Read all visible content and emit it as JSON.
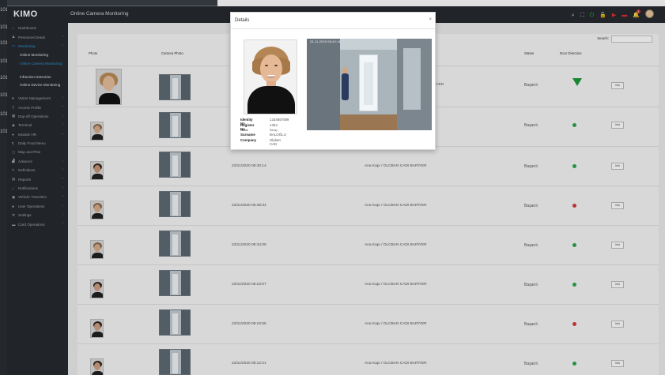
{
  "left_edge_labels": [
    "101",
    "101",
    "101",
    "101",
    "101",
    "101",
    "101",
    "101"
  ],
  "app": {
    "logo": "KIMO",
    "title": "Online Camera Monitoring"
  },
  "sidebar": {
    "items": [
      {
        "label": "Dashboard",
        "icon": "home-icon"
      },
      {
        "label": "Personnel Detail",
        "icon": "users-icon",
        "arrow": "‹"
      },
      {
        "label": "Monitoring",
        "icon": "monitor-icon",
        "arrow": "‹"
      },
      {
        "label": "Online Monitoring"
      },
      {
        "label": "Online Camera Monitoring"
      },
      {
        "label": "Infraction Detection"
      },
      {
        "label": "Online Device Monitoring"
      },
      {
        "label": "Visitor Management",
        "icon": "visitor-icon",
        "arrow": "‹"
      },
      {
        "label": "Access Profile",
        "icon": "key-icon",
        "arrow": "‹"
      },
      {
        "label": "Day-off Operations",
        "icon": "calendar-icon",
        "arrow": "‹"
      },
      {
        "label": "Terminal",
        "icon": "terminal-icon",
        "arrow": "‹"
      },
      {
        "label": "Module HR",
        "icon": "hr-icon",
        "arrow": "‹"
      },
      {
        "label": "Daily Food Menu",
        "icon": "food-icon"
      },
      {
        "label": "Map and Plan",
        "icon": "map-icon"
      },
      {
        "label": "Advance",
        "icon": "chart-icon",
        "arrow": "‹"
      },
      {
        "label": "Definitions",
        "icon": "pencil-icon",
        "arrow": "‹"
      },
      {
        "label": "Reports",
        "icon": "report-icon",
        "arrow": "‹"
      },
      {
        "label": "Notifications",
        "icon": "bell-icon",
        "arrow": "‹"
      },
      {
        "label": "Vehicle Transition",
        "icon": "car-icon",
        "arrow": "‹"
      },
      {
        "label": "User Operations",
        "icon": "user-ops-icon",
        "arrow": "‹"
      },
      {
        "label": "Settings",
        "icon": "wrench-icon",
        "arrow": "‹"
      },
      {
        "label": "Card Operations",
        "icon": "card-icon",
        "arrow": "‹"
      }
    ]
  },
  "topbar": {
    "icons": [
      {
        "name": "search-icon",
        "glyph": "⌕",
        "color": "#cfd3d7"
      },
      {
        "name": "expand-icon",
        "glyph": "⛶",
        "color": "#cfd3d7"
      },
      {
        "name": "power-icon",
        "glyph": "⏻",
        "color": "#27b24a"
      },
      {
        "name": "unlock-icon",
        "glyph": "🔓",
        "color": "#27b24a"
      },
      {
        "name": "camera-icon",
        "glyph": "▶",
        "color": "#d93030"
      },
      {
        "name": "flag-icon",
        "glyph": "▬",
        "color": "#d93030"
      },
      {
        "name": "notification-icon",
        "glyph": "🔔",
        "color": "#d93030"
      }
    ],
    "notification_badge": "1"
  },
  "table": {
    "search_label": "Search:",
    "headers": [
      "Photo",
      "Camera Photo",
      "Status",
      "Door Direction"
    ],
    "rows": [
      {
        "time": "",
        "door": "IYER",
        "status": "Başarılı",
        "direction": "in",
        "info": "Info"
      },
      {
        "time": "",
        "door": "",
        "status": "Başarılı",
        "direction": "in",
        "info": "Info"
      },
      {
        "time": "23/11/2020 08:40:14",
        "door": "Ana Kapı / OLCBAN CADI BARİYER",
        "status": "Başarılı",
        "direction": "in",
        "info": "Info"
      },
      {
        "time": "23/11/2020 08:38:34",
        "door": "Ana Kapı / OLCBAN CADI BARİYER",
        "status": "Başarılı",
        "direction": "out",
        "info": "Info"
      },
      {
        "time": "23/11/2020 08:34:09",
        "door": "Ana Kapı / OLCBAN CADI BARİYER",
        "status": "Başarılı",
        "direction": "in",
        "info": "Info"
      },
      {
        "time": "23/11/2020 08:23:07",
        "door": "Ana Kapı / OLCBAN CADI BARİYER",
        "status": "Başarılı",
        "direction": "in",
        "info": "Info"
      },
      {
        "time": "23/11/2020 08:16:56",
        "door": "Ana Kapı / OLCBAN CADI BARİYER",
        "status": "Başarılı",
        "direction": "out",
        "info": "Info"
      },
      {
        "time": "23/11/2020 08:12:21",
        "door": "Ana Kapı / OLCBAN CADI BARİYER",
        "status": "Başarılı",
        "direction": "in",
        "info": "Info"
      }
    ]
  },
  "modal": {
    "title": "Details",
    "close": "×",
    "camera_timestamp": "23-11-2020 08:40:14",
    "fields": [
      {
        "label": "Identity No",
        "value": "1334657089"
      },
      {
        "label": "Register No",
        "value": "1334"
      },
      {
        "label": "Name",
        "value": "Serap"
      },
      {
        "label": "Surname",
        "value": "BALOĞLU"
      },
      {
        "label": "Company",
        "value": "Olçban CAD"
      }
    ]
  }
}
